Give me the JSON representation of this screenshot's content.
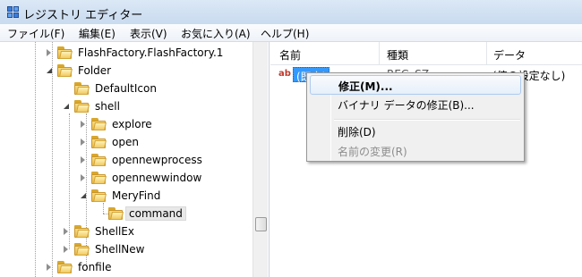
{
  "window": {
    "title": "レジストリ エディター",
    "icon": "registry-editor-icon"
  },
  "menubar": {
    "items": [
      {
        "label": "ファイル(F)"
      },
      {
        "label": "編集(E)"
      },
      {
        "label": "表示(V)"
      },
      {
        "label": "お気に入り(A)"
      },
      {
        "label": "ヘルプ(H)"
      }
    ]
  },
  "tree": {
    "nodes": [
      {
        "label": "FlashFactory.FlashFactory.1",
        "depth": 0,
        "expander": "collapsed",
        "selected": false
      },
      {
        "label": "Folder",
        "depth": 0,
        "expander": "expanded",
        "selected": false
      },
      {
        "label": "DefaultIcon",
        "depth": 1,
        "expander": "none",
        "selected": false
      },
      {
        "label": "shell",
        "depth": 1,
        "expander": "expanded",
        "selected": false
      },
      {
        "label": "explore",
        "depth": 2,
        "expander": "collapsed",
        "selected": false
      },
      {
        "label": "open",
        "depth": 2,
        "expander": "collapsed",
        "selected": false
      },
      {
        "label": "opennewprocess",
        "depth": 2,
        "expander": "collapsed",
        "selected": false
      },
      {
        "label": "opennewwindow",
        "depth": 2,
        "expander": "collapsed",
        "selected": false
      },
      {
        "label": "MeryFind",
        "depth": 2,
        "expander": "expanded",
        "selected": false
      },
      {
        "label": "command",
        "depth": 3,
        "expander": "none",
        "selected": true
      },
      {
        "label": "ShellEx",
        "depth": 1,
        "expander": "collapsed",
        "selected": false
      },
      {
        "label": "ShellNew",
        "depth": 1,
        "expander": "collapsed",
        "selected": false
      },
      {
        "label": "fonfile",
        "depth": 0,
        "expander": "collapsed",
        "selected": false
      }
    ]
  },
  "list": {
    "columns": [
      {
        "label": "名前"
      },
      {
        "label": "種類"
      },
      {
        "label": "データ"
      }
    ],
    "rows": [
      {
        "name": "(既定)",
        "type": "REG_SZ",
        "data": "(値の設定なし)",
        "icon": "string-value-icon"
      }
    ]
  },
  "context_menu": {
    "items": [
      {
        "label": "修正(M)...",
        "bold": true,
        "hover": true,
        "disabled": false
      },
      {
        "label": "バイナリ データの修正(B)...",
        "bold": false,
        "hover": false,
        "disabled": false
      },
      {
        "label": "削除(D)",
        "bold": false,
        "hover": false,
        "disabled": false
      },
      {
        "label": "名前の変更(R)",
        "bold": false,
        "hover": false,
        "disabled": true
      }
    ]
  },
  "colors": {
    "selection": "#3399ff",
    "titlebar": "#dbe8f6",
    "menu_hover_border": "#aecbf0"
  }
}
